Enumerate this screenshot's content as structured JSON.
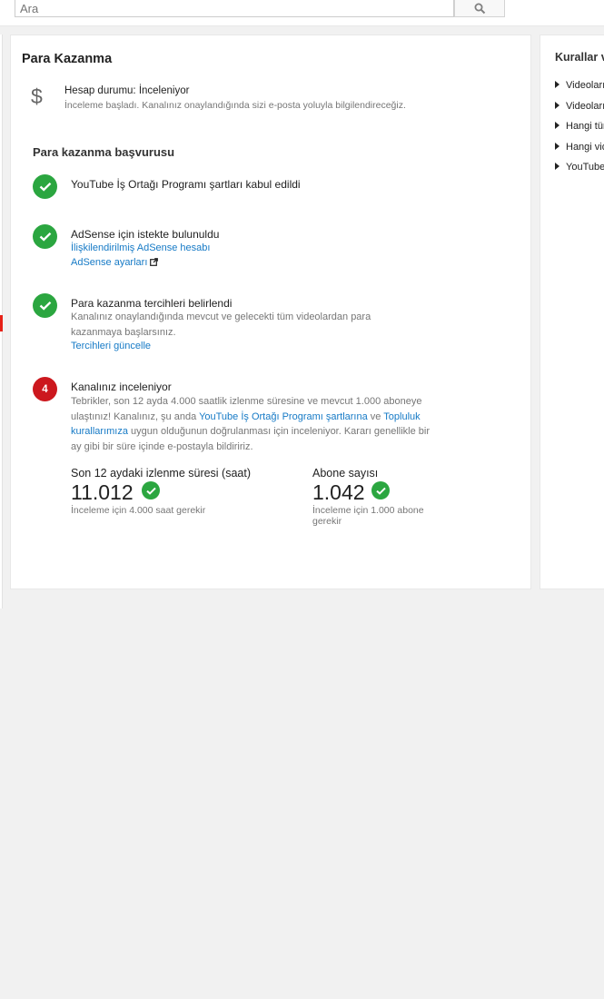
{
  "search": {
    "placeholder": "Ara"
  },
  "monetization": {
    "title": "Para Kazanma",
    "account_status": "Hesap durumu: İnceleniyor",
    "account_status_desc": "İnceleme başladı. Kanalınız onaylandığında sizi e-posta yoluyla bilgilendireceğiz.",
    "application_title": "Para kazanma başvurusu",
    "steps": [
      {
        "title": "YouTube İş Ortağı Programı şartları kabul edildi",
        "state": "done"
      },
      {
        "title": "AdSense için istekte bulunuldu",
        "state": "done",
        "links": [
          "İlişkilendirilmiş AdSense hesabı",
          "AdSense ayarları"
        ]
      },
      {
        "title": "Para kazanma tercihleri belirlendi",
        "state": "done",
        "desc_line1": "Kanalınız onaylandığında mevcut ve gelecekti tüm videolardan para",
        "desc_line2": "kazanmaya başlarsınız.",
        "link": "Tercihleri güncelle"
      },
      {
        "title": "Kanalınız inceleniyor",
        "state": "in-progress",
        "number": "4",
        "desc_a": "Tebrikler, son 12 ayda 4.000 saatlik izlenme süresine ve mevcut 1.000 aboneye ulaştınız! Kanalınız, şu anda ",
        "desc_link1": "YouTube İş Ortağı Programı şartlarına",
        "desc_b": " ve ",
        "desc_link2": "Topluluk kurallarımıza",
        "desc_c": " uygun olduğunun doğrulanması için inceleniyor. Kararı genellikle bir ay gibi bir süre içinde e-postayla bildiririz."
      }
    ],
    "stats": {
      "watch_time": {
        "label": "Son 12 aydaki izlenme süresi (saat)",
        "value": "11.012",
        "requirement": "İnceleme için 4.000 saat gerekir"
      },
      "subscribers": {
        "label": "Abone sayısı",
        "value": "1.042",
        "requirement_line1": "İnceleme için 1.000 abone",
        "requirement_line2": "gerekir"
      }
    }
  },
  "sidebar": {
    "title": "Kurallar v",
    "items": [
      "Videoları",
      "Videoları",
      "Hangi tür",
      "Hangi vid",
      "YouTube"
    ]
  },
  "colors": {
    "success": "#2ba640",
    "error": "#cc181e",
    "link": "#167ac6"
  }
}
